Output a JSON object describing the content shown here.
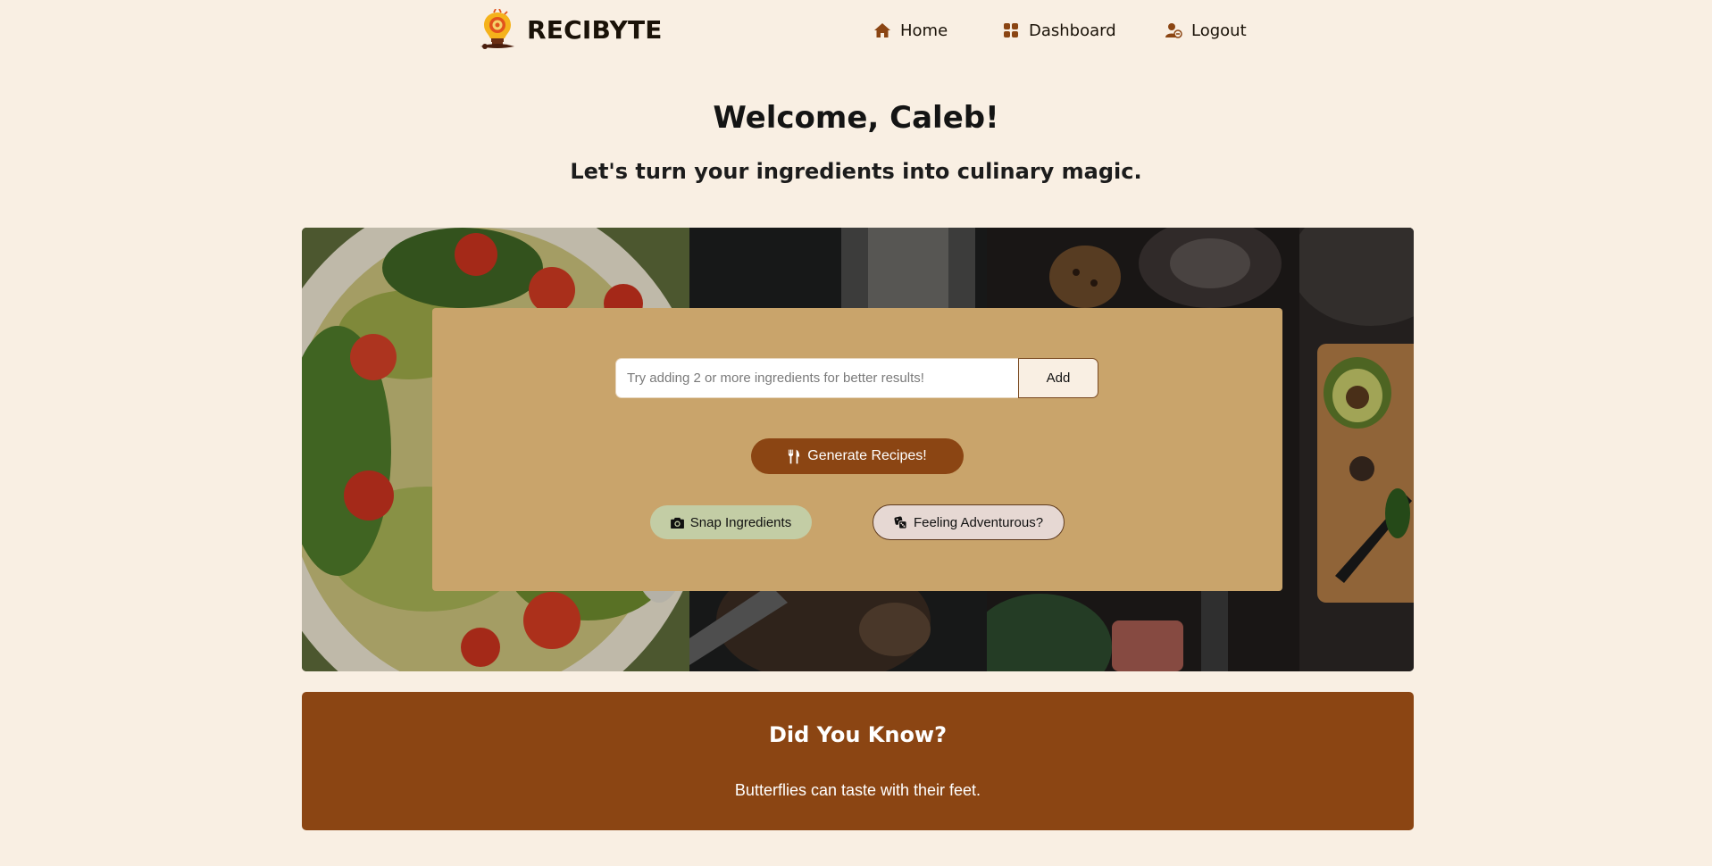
{
  "app": {
    "name": "RECIBYTE"
  },
  "nav": {
    "home": "Home",
    "dashboard": "Dashboard",
    "logout": "Logout",
    "icons": [
      "house-icon",
      "dashboard-grid-icon",
      "user-logout-icon"
    ]
  },
  "header": {
    "welcome": "Welcome, Caleb!",
    "tagline": "Let's turn your ingredients into culinary magic."
  },
  "ingredients": {
    "placeholder": "Try adding 2 or more ingredients for better results!",
    "value": "",
    "add_label": "Add"
  },
  "actions": {
    "generate": "Generate Recipes!",
    "snap": "Snap Ingredients",
    "adventurous": "Feeling Adventurous?"
  },
  "fact": {
    "title": "Did You Know?",
    "text": "Butterflies can taste with their feet."
  },
  "colors": {
    "background": "#f9efe3",
    "brand_brown": "#8b4513",
    "panel_tan": "#c9a46b",
    "snap_green": "#c3cda5",
    "adventure_gray": "#e6d8d3"
  }
}
